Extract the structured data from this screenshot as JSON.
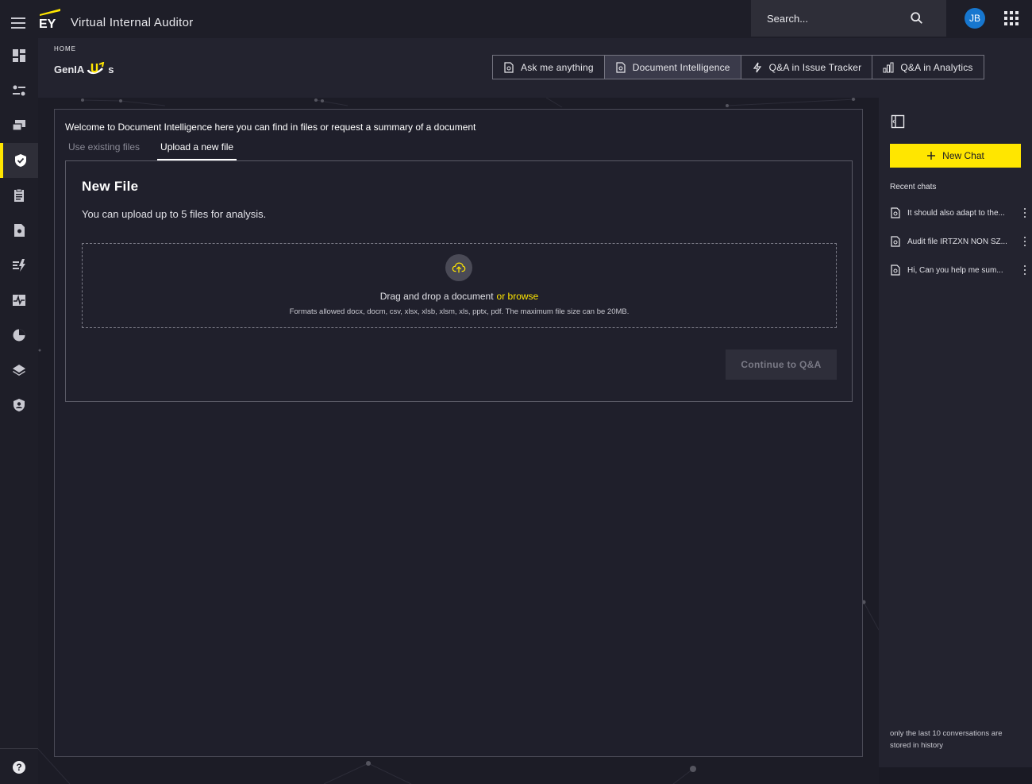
{
  "app": {
    "title": "Virtual Internal Auditor",
    "logo_text": "EY"
  },
  "search": {
    "placeholder": "Search..."
  },
  "user": {
    "initials": "JB"
  },
  "header": {
    "breadcrumb": "HOME",
    "brand_prefix": "GenIA",
    "brand_suffix": "s",
    "modes": [
      {
        "label": "Ask me anything",
        "icon": "document-ai-icon"
      },
      {
        "label": "Document Intelligence",
        "icon": "document-ai-icon"
      },
      {
        "label": "Q&A in Issue Tracker",
        "icon": "lightning-icon"
      },
      {
        "label": "Q&A in Analytics",
        "icon": "bar-chart-icon"
      }
    ]
  },
  "sidebar": {
    "items": [
      {
        "icon": "dashboard-icon"
      },
      {
        "icon": "settings-sliders-icon"
      },
      {
        "icon": "chat-bubbles-icon"
      },
      {
        "icon": "shield-check-icon"
      },
      {
        "icon": "clipboard-icon"
      },
      {
        "icon": "document-settings-icon"
      },
      {
        "icon": "analytics-lightning-icon"
      },
      {
        "icon": "pulse-icon"
      },
      {
        "icon": "pie-chart-icon"
      },
      {
        "icon": "layers-icon"
      },
      {
        "icon": "user-shield-icon"
      }
    ],
    "help_label": "?"
  },
  "main": {
    "welcome": "Welcome to Document Intelligence here you can find in files or request a summary of a document",
    "tabs": [
      {
        "label": "Use existing files"
      },
      {
        "label": "Upload a new file"
      }
    ],
    "card": {
      "title": "New File",
      "subtitle": "You can upload up to 5 files for analysis.",
      "drag_text": "Drag and drop a document",
      "browse_text": "or browse",
      "formats": "Formats allowed docx, docm, csv, xlsx, xlsb, xlsm, xls, pptx, pdf. The maximum file size can be 20MB.",
      "continue_label": "Continue to Q&A"
    }
  },
  "right_panel": {
    "new_chat_label": "New Chat",
    "recent_label": "Recent chats",
    "chats": [
      {
        "label": "It should also adapt to the..."
      },
      {
        "label": "Audit file IRTZXN NON SZ..."
      },
      {
        "label": "Hi, Can you help me sum..."
      }
    ],
    "history_note": "only the last 10 conversations are stored in history"
  },
  "colors": {
    "accent": "#ffe600",
    "background": "#1a1a24",
    "avatar": "#1777cf"
  }
}
